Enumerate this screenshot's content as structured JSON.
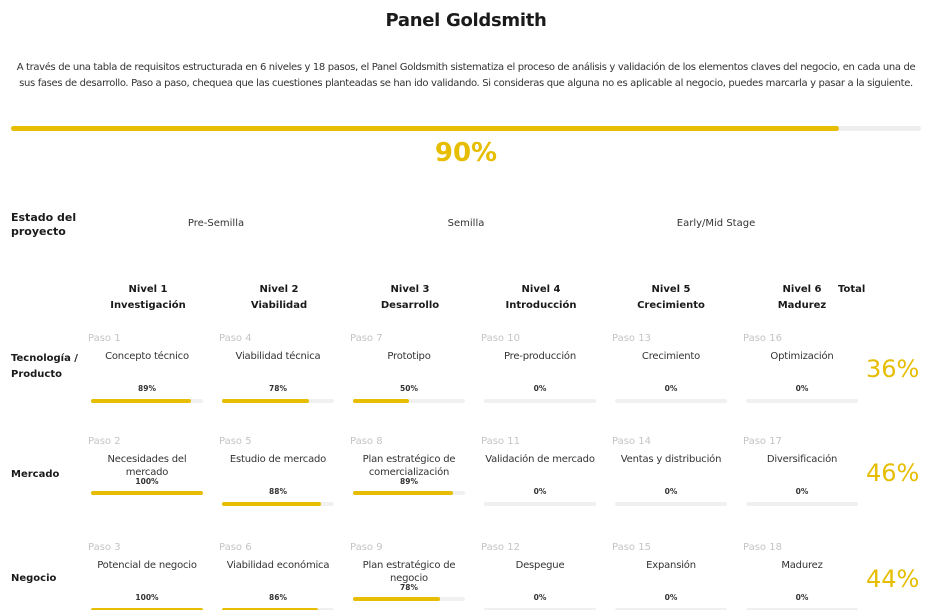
{
  "header": {
    "title": "Panel Goldsmith",
    "description": "A través de una tabla de requisitos estructurada en 6 niveles y 18 pasos, el Panel Goldsmith sistematiza el proceso de análisis y validación de los elementos claves del negocio, en cada una de sus fases de desarrollo. Paso a paso, chequea que las cuestiones planteadas se han ido validando. Si consideras que alguna no es aplicable al negocio, puedes marcarla y pasar a la siguiente."
  },
  "overall": {
    "percent_label": "90%",
    "progress": 0.91
  },
  "estado": {
    "label": "Estado del proyecto",
    "stages": [
      "Pre-Semilla",
      "Semilla",
      "Early/Mid Stage"
    ]
  },
  "columns": [
    {
      "nivel": "Nivel 1",
      "name": "Investigación"
    },
    {
      "nivel": "Nivel 2",
      "name": "Viabilidad"
    },
    {
      "nivel": "Nivel 3",
      "name": "Desarrollo"
    },
    {
      "nivel": "Nivel 4",
      "name": "Introducción"
    },
    {
      "nivel": "Nivel 5",
      "name": "Crecimiento"
    },
    {
      "nivel": "Nivel 6",
      "name": "Madurez"
    }
  ],
  "total_label": "Total",
  "rows": [
    {
      "label": "Tecnología / Producto",
      "total": "36%",
      "cells": [
        {
          "paso": "Paso 1",
          "name": "Concepto técnico",
          "pct": "89%",
          "progress": 0.89
        },
        {
          "paso": "Paso 4",
          "name": "Viabilidad técnica",
          "pct": "78%",
          "progress": 0.78
        },
        {
          "paso": "Paso 7",
          "name": "Prototipo",
          "pct": "50%",
          "progress": 0.5
        },
        {
          "paso": "Paso 10",
          "name": "Pre-producción",
          "pct": "0%",
          "progress": 0
        },
        {
          "paso": "Paso 13",
          "name": "Crecimiento",
          "pct": "0%",
          "progress": 0
        },
        {
          "paso": "Paso 16",
          "name": "Optimización",
          "pct": "0%",
          "progress": 0
        }
      ]
    },
    {
      "label": "Mercado",
      "total": "46%",
      "cells": [
        {
          "paso": "Paso 2",
          "name": "Necesidades del mercado",
          "pct": "100%",
          "progress": 1.0
        },
        {
          "paso": "Paso 5",
          "name": "Estudio de mercado",
          "pct": "88%",
          "progress": 0.88
        },
        {
          "paso": "Paso 8",
          "name": "Plan estratégico de comercialización",
          "pct": "89%",
          "progress": 0.89
        },
        {
          "paso": "Paso 11",
          "name": "Validación de mercado",
          "pct": "0%",
          "progress": 0
        },
        {
          "paso": "Paso 14",
          "name": "Ventas y distribución",
          "pct": "0%",
          "progress": 0
        },
        {
          "paso": "Paso 17",
          "name": "Diversificación",
          "pct": "0%",
          "progress": 0
        }
      ]
    },
    {
      "label": "Negocio",
      "total": "44%",
      "cells": [
        {
          "paso": "Paso 3",
          "name": "Potencial de negocio",
          "pct": "100%",
          "progress": 1.0
        },
        {
          "paso": "Paso 6",
          "name": "Viabilidad económica",
          "pct": "86%",
          "progress": 0.86
        },
        {
          "paso": "Paso 9",
          "name": "Plan estratégico de negocio",
          "pct": "78%",
          "progress": 0.78
        },
        {
          "paso": "Paso 12",
          "name": "Despegue",
          "pct": "0%",
          "progress": 0
        },
        {
          "paso": "Paso 15",
          "name": "Expansión",
          "pct": "0%",
          "progress": 0
        },
        {
          "paso": "Paso 18",
          "name": "Madurez",
          "pct": "0%",
          "progress": 0
        }
      ]
    }
  ],
  "colors": {
    "accent": "#e6bd00",
    "track": "#f0f0f0",
    "muted": "#c4c4c4"
  }
}
